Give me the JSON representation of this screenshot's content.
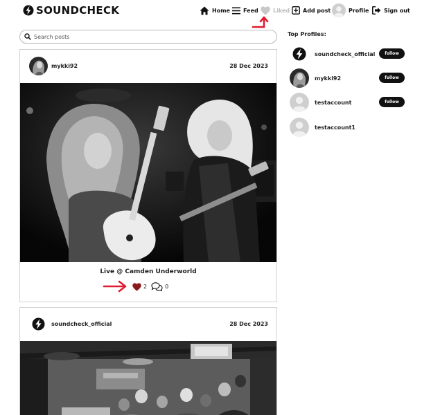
{
  "app": {
    "name": "SOUNDCHECK"
  },
  "colors": {
    "accent_red": "#e01b2f",
    "heart_dark": "#8b1a1a",
    "follow_bg": "#111111",
    "liked_disabled": "#bbbbbb"
  },
  "nav": {
    "home": "Home",
    "feed": "Feed",
    "liked": "Liked",
    "add_post": "Add post",
    "profile": "Profile",
    "sign_out": "Sign out"
  },
  "search": {
    "placeholder": "Search posts",
    "value": ""
  },
  "posts": [
    {
      "user": "mykki92",
      "date": "28 Dec 2023",
      "caption": "Live @ Camden Underworld",
      "likes": "2",
      "comments": "0",
      "liked": true,
      "icons": {
        "like": "heart-icon",
        "comment": "comments-icon"
      }
    },
    {
      "user": "soundcheck_official",
      "date": "28 Dec 2023"
    }
  ],
  "sidebar": {
    "title": "Top Profiles:",
    "follow_label": "follow",
    "profiles": [
      {
        "name": "soundcheck_official",
        "show_follow": true
      },
      {
        "name": "mykki92",
        "show_follow": true
      },
      {
        "name": "testaccount",
        "show_follow": true
      },
      {
        "name": "testaccount1",
        "show_follow": false
      }
    ]
  }
}
